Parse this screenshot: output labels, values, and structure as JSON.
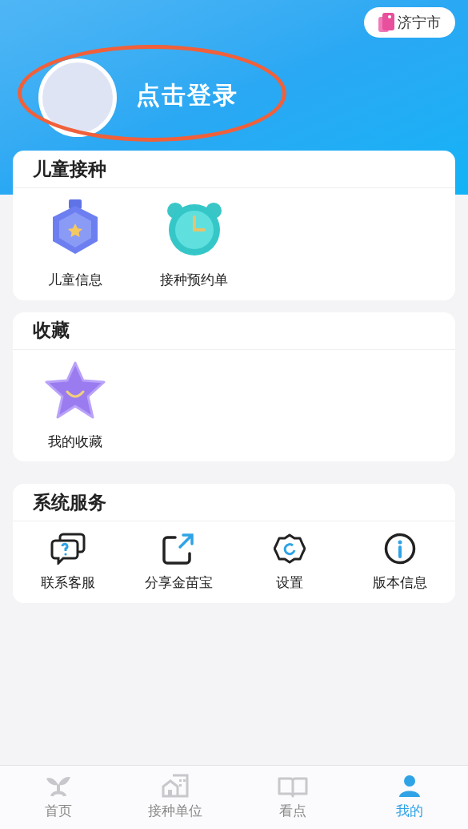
{
  "location": {
    "label": "济宁市"
  },
  "login": {
    "label": "点击登录"
  },
  "sections": [
    {
      "title": "儿童接种",
      "kind": "large",
      "items": [
        {
          "kind": "medal",
          "label": "儿童信息"
        },
        {
          "kind": "clock",
          "label": "接种预约单"
        }
      ]
    },
    {
      "title": "收藏",
      "kind": "large",
      "items": [
        {
          "kind": "star",
          "label": "我的收藏"
        }
      ]
    },
    {
      "title": "系统服务",
      "kind": "small",
      "items": [
        {
          "kind": "chat",
          "label": "联系客服"
        },
        {
          "kind": "share",
          "label": "分享金苗宝"
        },
        {
          "kind": "gear",
          "label": "设置"
        },
        {
          "kind": "info",
          "label": "版本信息"
        }
      ]
    }
  ],
  "tabs": [
    {
      "kind": "sprout",
      "label": "首页",
      "selected": false
    },
    {
      "kind": "building",
      "label": "接种单位",
      "selected": false
    },
    {
      "kind": "book",
      "label": "看点",
      "selected": false
    },
    {
      "kind": "person",
      "label": "我的",
      "selected": true
    }
  ]
}
